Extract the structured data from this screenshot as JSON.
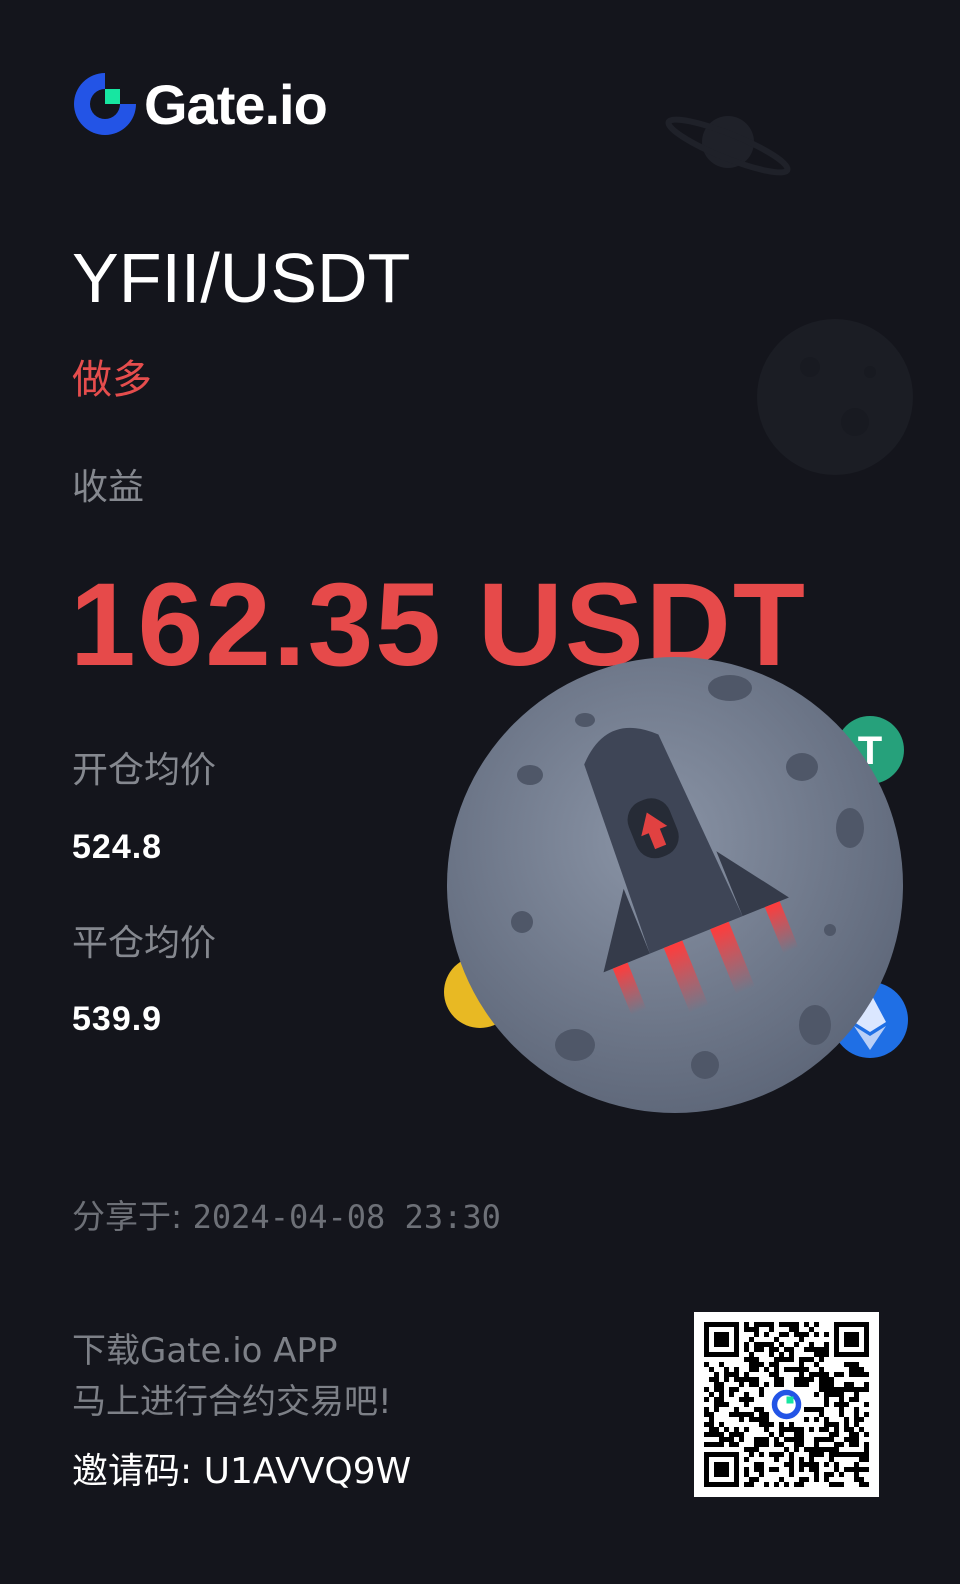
{
  "brand": {
    "name": "Gate.io",
    "accent": "#2354e6",
    "green": "#17e6a1"
  },
  "position": {
    "pair": "YFII/USDT",
    "direction": "做多",
    "pnl_label": "收益",
    "pnl_value": "162.35 USDT",
    "entry_label": "开仓均价",
    "entry_value": "524.8",
    "exit_label": "平仓均价",
    "exit_value": "539.9"
  },
  "share": {
    "label": "分享于:",
    "timestamp": "2024-04-08 23:30"
  },
  "promo": {
    "line1": "下载Gate.io APP",
    "line2": "马上进行合约交易吧!",
    "invite_label": "邀请码:",
    "invite_code": "U1AVVQ9W"
  },
  "colors": {
    "background": "#14151c",
    "loss_profit_red": "#e64a4a",
    "muted_text": "#85888f"
  }
}
